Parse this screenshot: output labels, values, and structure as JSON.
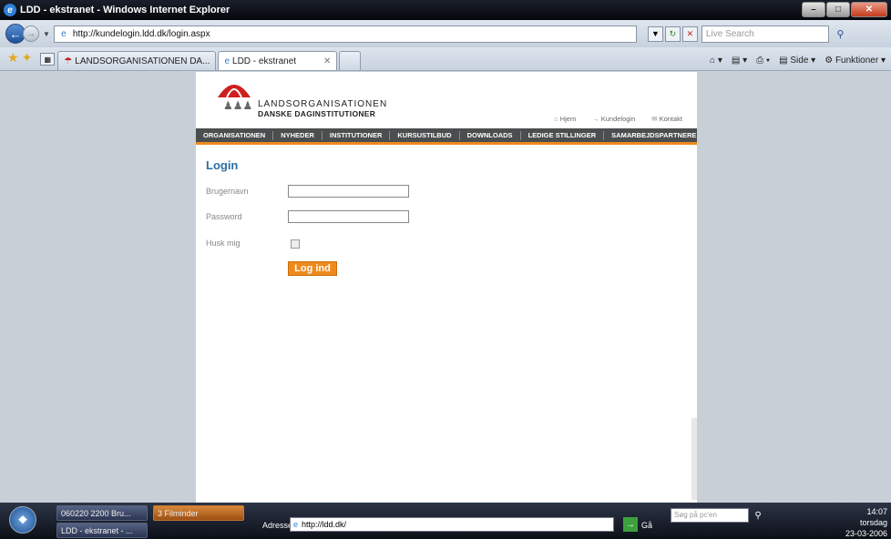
{
  "window": {
    "title": "LDD - ekstranet - Windows Internet Explorer"
  },
  "address_bar": {
    "url": "http://kundelogin.ldd.dk/login.aspx"
  },
  "search": {
    "placeholder": "Live Search"
  },
  "tabs": [
    {
      "label": "LANDSORGANISATIONEN DA..."
    },
    {
      "label": "LDD - ekstranet"
    }
  ],
  "commandbar": {
    "side": "Side",
    "functions": "Funktioner"
  },
  "site": {
    "org_line1": "LANDSORGANISATIONEN",
    "org_line2": "DANSKE DAGINSTITUTIONER",
    "top_links": [
      "Hjem",
      "Kundelogin",
      "Kontakt"
    ],
    "menu": [
      "ORGANISATIONEN",
      "NYHEDER",
      "INSTITUTIONER",
      "KURSUSTILBUD",
      "DOWNLOADS",
      "LEDIGE STILLINGER",
      "SAMARBEJDSPARTNERE"
    ]
  },
  "login": {
    "title": "Login",
    "username_label": "Brugernavn",
    "password_label": "Password",
    "remember_label": "Husk mig",
    "button": "Log ind"
  },
  "taskbar": {
    "tasks": [
      "060220 2200 Bru...",
      "3 Filminder",
      "LDD - ekstranet - ..."
    ],
    "address_label": "Adresse",
    "address_value": "http://ldd.dk/",
    "go_label": "Gå",
    "search_placeholder": "Søg på pc'en",
    "time": "14:07",
    "day": "torsdag",
    "date": "23-03-2006"
  }
}
